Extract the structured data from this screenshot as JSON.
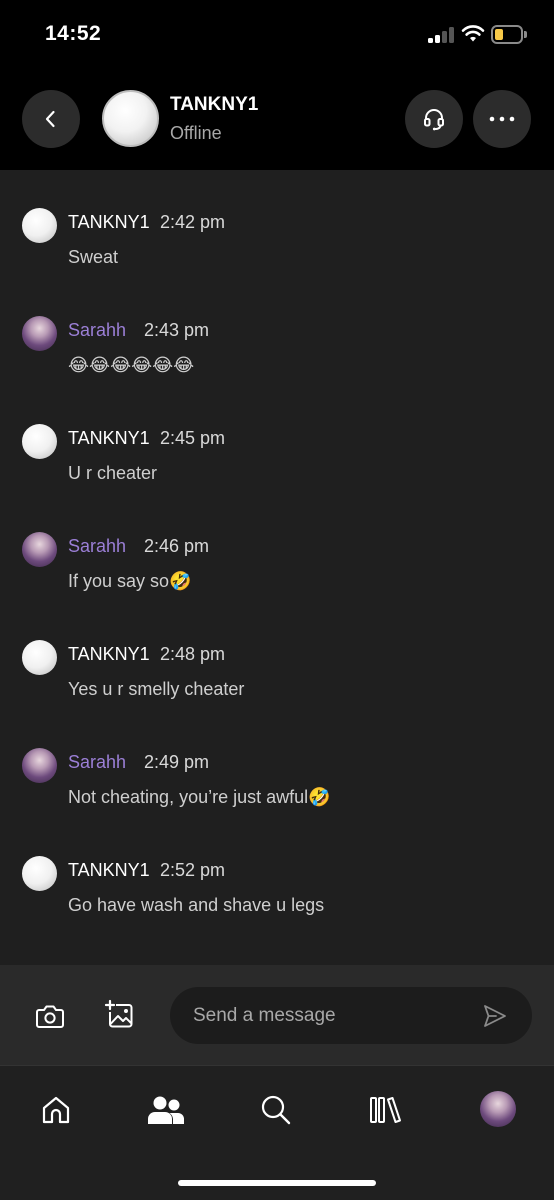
{
  "status_bar": {
    "time": "14:52"
  },
  "header": {
    "contact_name": "TANKNY1",
    "contact_status": "Offline",
    "icons": {
      "back": "chevron-left-icon",
      "headset": "headset-icon",
      "more": "more-dots-icon"
    }
  },
  "messages": [
    {
      "sender": "TANKNY1",
      "time": "2:42 pm",
      "text": "Sweat"
    },
    {
      "sender": "Sarahh",
      "time": "2:43 pm",
      "text": "😂😂😂😂😂😂"
    },
    {
      "sender": "TANKNY1",
      "time": "2:45 pm",
      "text": "U r cheater"
    },
    {
      "sender": "Sarahh",
      "time": "2:46 pm",
      "text": "If you say so🤣"
    },
    {
      "sender": "TANKNY1",
      "time": "2:48 pm",
      "text": "Yes u r smelly cheater"
    },
    {
      "sender": "Sarahh",
      "time": "2:49 pm",
      "text": "Not cheating, you’re just awful🤣"
    },
    {
      "sender": "TANKNY1",
      "time": "2:52 pm",
      "text": "Go have wash and shave u legs"
    }
  ],
  "composer": {
    "placeholder": "Send a message",
    "icons": {
      "camera": "camera-icon",
      "image": "add-image-icon",
      "send": "send-icon"
    }
  },
  "bottom_nav": {
    "items": [
      "home-icon",
      "friends-icon",
      "search-icon",
      "library-icon",
      "profile-avatar"
    ],
    "active": "friends-icon"
  },
  "colors": {
    "background": "#000000",
    "chat_background": "#1f1f1f",
    "own_name": "#9b7fd6",
    "other_name": "#ffffff",
    "message_text": "#cfcfcf"
  }
}
